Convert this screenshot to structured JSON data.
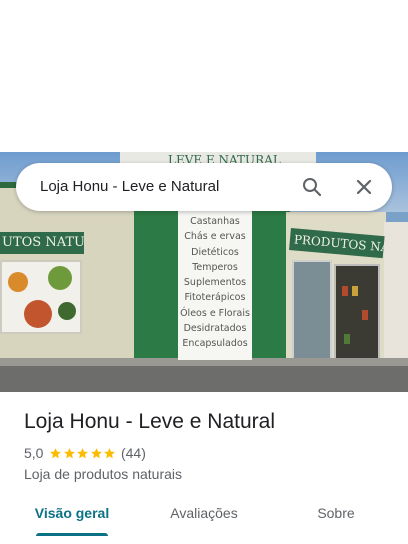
{
  "search": {
    "query": "Loja Honu - Leve e Natural",
    "search_icon": "search-icon",
    "close_icon": "close-icon"
  },
  "photo": {
    "sign_left": "UTOS NATURAIS",
    "sign_right": "PRODUTOS NATURAIS",
    "sign_top": "LEVE E NATURAL",
    "board_items": [
      "Castanhas",
      "Chás e ervas",
      "Dietéticos",
      "Temperos",
      "Suplementos",
      "Fitoterápicos",
      "Óleos e Florais",
      "Desidratados",
      "Encapsulados"
    ]
  },
  "place": {
    "title": "Loja Honu - Leve e Natural",
    "rating": "5,0",
    "stars": 5,
    "review_count": "(44)",
    "category": "Loja de produtos naturais"
  },
  "tabs": [
    {
      "label": "Visão geral",
      "active": true
    },
    {
      "label": "Avaliações",
      "active": false
    },
    {
      "label": "Sobre",
      "active": false
    }
  ],
  "colors": {
    "accent": "#0b7285",
    "star": "#fbbc04",
    "text_secondary": "#5f6368"
  }
}
